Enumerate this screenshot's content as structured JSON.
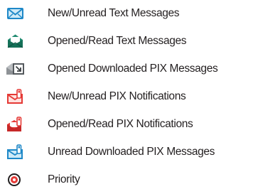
{
  "legend": {
    "items": [
      {
        "label": "New/Unread Text Messages",
        "icon": "new-unread-text-message-icon",
        "color": "#1e88c8"
      },
      {
        "label": "Opened/Read Text Messages",
        "icon": "opened-read-text-message-icon",
        "color": "#1f8a70"
      },
      {
        "label": "Opened Downloaded PIX Messages",
        "icon": "opened-downloaded-pix-message-icon",
        "color": "#8e9296"
      },
      {
        "label": "New/Unread PIX Notifications",
        "icon": "new-unread-pix-notification-icon",
        "color": "#e53935"
      },
      {
        "label": "Opened/Read PIX Notifications",
        "icon": "opened-read-pix-notification-icon",
        "color": "#e53935"
      },
      {
        "label": "Unread Downloaded PIX Messages",
        "icon": "unread-downloaded-pix-message-icon",
        "color": "#1e88c8"
      },
      {
        "label": "Priority",
        "icon": "priority-icon",
        "color": "#e53935"
      }
    ]
  }
}
